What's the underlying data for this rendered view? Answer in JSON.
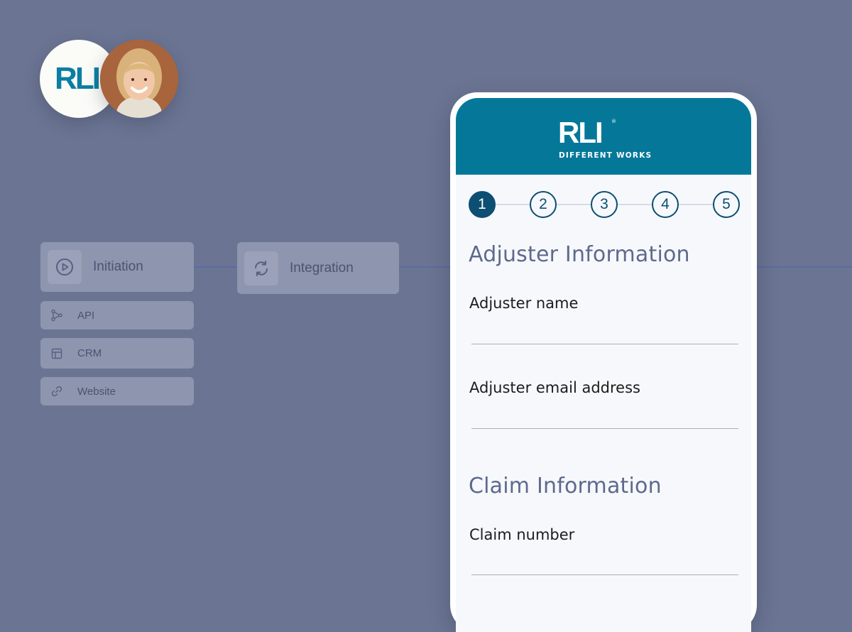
{
  "avatars": {
    "logo_text": "RLI"
  },
  "flow": {
    "initiation": {
      "label": "Initiation",
      "icon": "play-circle-icon"
    },
    "integration": {
      "label": "Integration",
      "icon": "refresh-icon"
    },
    "sources": [
      {
        "label": "API",
        "icon": "branch-icon"
      },
      {
        "label": "CRM",
        "icon": "layout-icon"
      },
      {
        "label": "Website",
        "icon": "link-icon"
      }
    ]
  },
  "form": {
    "brand": {
      "mark": "RLI",
      "registered": "®",
      "tagline": "DIFFERENT WORKS",
      "color": "#05789a"
    },
    "steps": [
      "1",
      "2",
      "3",
      "4",
      "5"
    ],
    "active_step": 1,
    "sections": [
      {
        "title": "Adjuster Information",
        "fields": [
          "Adjuster name",
          "Adjuster email address"
        ]
      },
      {
        "title": "Claim Information",
        "fields": [
          "Claim number"
        ]
      }
    ]
  },
  "colors": {
    "background": "#6b7593",
    "step_accent": "#0c4f72",
    "heading": "#5e6a8c"
  }
}
